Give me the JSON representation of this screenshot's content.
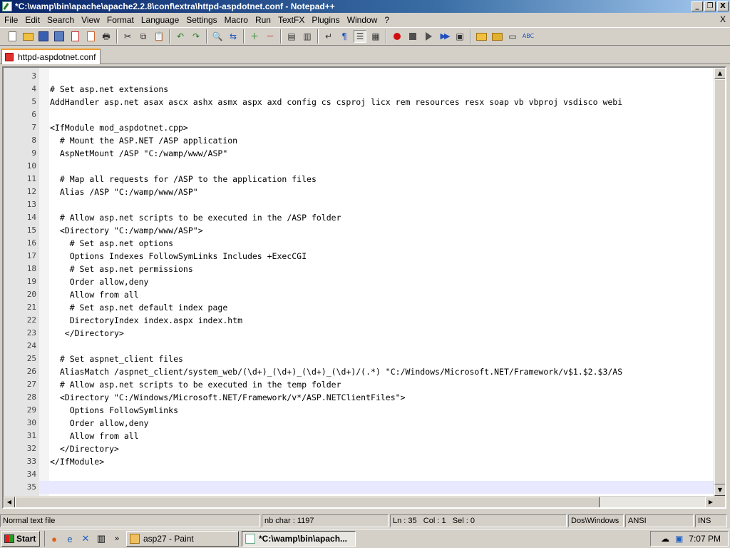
{
  "window": {
    "title": "*C:\\wamp\\bin\\apache\\apache2.2.8\\conf\\extra\\httpd-aspdotnet.conf - Notepad++",
    "buttons": {
      "minimize": "_",
      "restore": "❐",
      "close": "X"
    }
  },
  "menu": {
    "items": [
      "File",
      "Edit",
      "Search",
      "View",
      "Format",
      "Language",
      "Settings",
      "Macro",
      "Run",
      "TextFX",
      "Plugins",
      "Window",
      "?"
    ],
    "close_glyph": "X"
  },
  "tab": {
    "label": "httpd-aspdotnet.conf"
  },
  "editor": {
    "lines": [
      {
        "n": "3",
        "text": ""
      },
      {
        "n": "4",
        "text": "# Set asp.net extensions"
      },
      {
        "n": "5",
        "text": "AddHandler asp.net asax ascx ashx asmx aspx axd config cs csproj licx rem resources resx soap vb vbproj vsdisco webi"
      },
      {
        "n": "6",
        "text": ""
      },
      {
        "n": "7",
        "text": "<IfModule mod_aspdotnet.cpp>"
      },
      {
        "n": "8",
        "text": "  # Mount the ASP.NET /ASP application"
      },
      {
        "n": "9",
        "text": "  AspNetMount /ASP \"C:/wamp/www/ASP\""
      },
      {
        "n": "10",
        "text": ""
      },
      {
        "n": "11",
        "text": "  # Map all requests for /ASP to the application files"
      },
      {
        "n": "12",
        "text": "  Alias /ASP \"C:/wamp/www/ASP\""
      },
      {
        "n": "13",
        "text": ""
      },
      {
        "n": "14",
        "text": "  # Allow asp.net scripts to be executed in the /ASP folder"
      },
      {
        "n": "15",
        "text": "  <Directory \"C:/wamp/www/ASP\">"
      },
      {
        "n": "16",
        "text": "    # Set asp.net options"
      },
      {
        "n": "17",
        "text": "    Options Indexes FollowSymLinks Includes +ExecCGI"
      },
      {
        "n": "18",
        "text": "    # Set asp.net permissions"
      },
      {
        "n": "19",
        "text": "    Order allow,deny"
      },
      {
        "n": "20",
        "text": "    Allow from all"
      },
      {
        "n": "21",
        "text": "    # Set asp.net default index page"
      },
      {
        "n": "22",
        "text": "    DirectoryIndex index.aspx index.htm"
      },
      {
        "n": "23",
        "text": "   </Directory>"
      },
      {
        "n": "24",
        "text": ""
      },
      {
        "n": "25",
        "text": "  # Set aspnet_client files"
      },
      {
        "n": "26",
        "text": "  AliasMatch /aspnet_client/system_web/(\\d+)_(\\d+)_(\\d+)_(\\d+)/(.*) \"C:/Windows/Microsoft.NET/Framework/v$1.$2.$3/AS"
      },
      {
        "n": "27",
        "text": "  # Allow asp.net scripts to be executed in the temp folder"
      },
      {
        "n": "28",
        "text": "  <Directory \"C:/Windows/Microsoft.NET/Framework/v*/ASP.NETClientFiles\">"
      },
      {
        "n": "29",
        "text": "    Options FollowSymlinks"
      },
      {
        "n": "30",
        "text": "    Order allow,deny"
      },
      {
        "n": "31",
        "text": "    Allow from all"
      },
      {
        "n": "32",
        "text": "  </Directory>"
      },
      {
        "n": "33",
        "text": "</IfModule>"
      },
      {
        "n": "34",
        "text": ""
      },
      {
        "n": "35",
        "text": ""
      }
    ],
    "current_line": "35"
  },
  "status": {
    "file_type": "Normal text file",
    "chars": "nb char : 1197",
    "position": "Ln : 35   Col : 1   Sel : 0",
    "eol": "Dos\\Windows",
    "encoding": "ANSI",
    "mode": "INS"
  },
  "taskbar": {
    "start": "Start",
    "tasks": [
      {
        "label": "asp27 - Paint",
        "active": false
      },
      {
        "label": "*C:\\wamp\\bin\\apach...",
        "active": true
      }
    ],
    "clock": "7:07 PM"
  },
  "colors": {
    "titlebar_start": "#0a246a",
    "titlebar_end": "#a6caf0",
    "tab_accent": "#f0a030",
    "current_line": "#e8e8ff"
  }
}
